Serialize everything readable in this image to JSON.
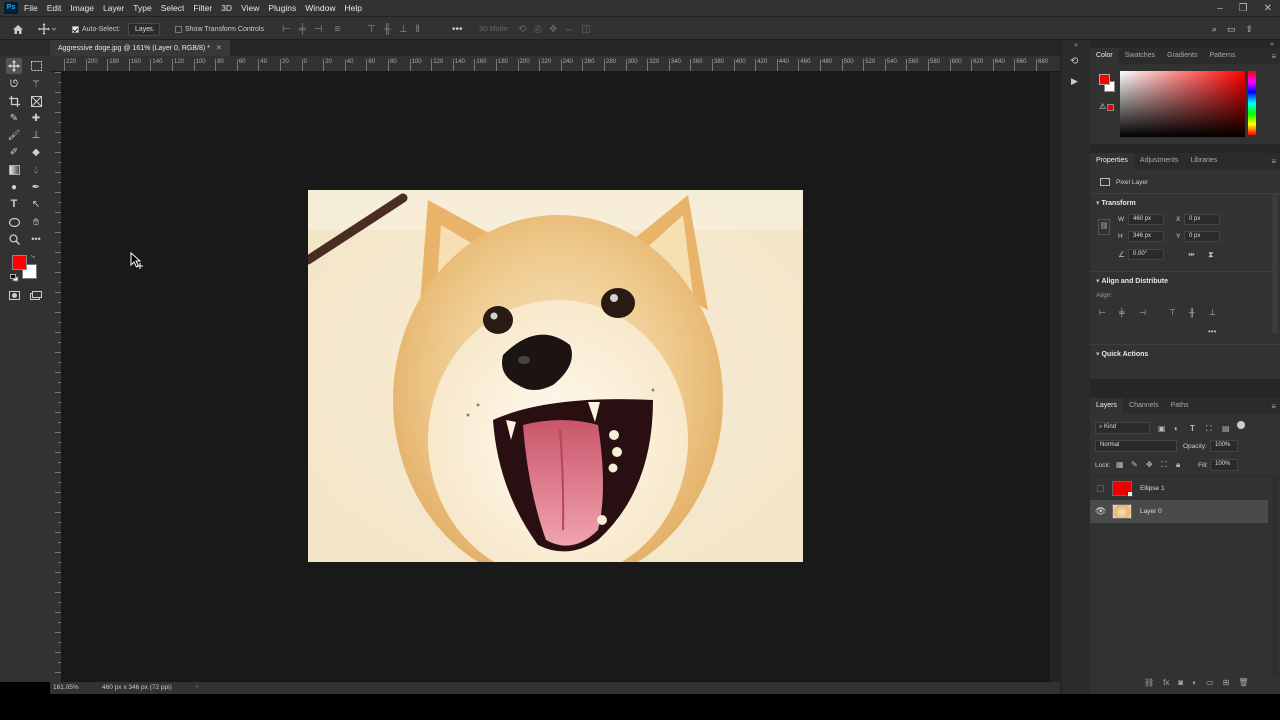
{
  "menu": {
    "logo": "Ps",
    "items": [
      "File",
      "Edit",
      "Image",
      "Layer",
      "Type",
      "Select",
      "Filter",
      "3D",
      "View",
      "Plugins",
      "Window",
      "Help"
    ]
  },
  "options": {
    "auto_select_label": "Auto-Select:",
    "auto_select_target": "Layer",
    "show_transform_label": "Show Transform Controls",
    "mode_3d_label": "3D Mode:"
  },
  "document": {
    "tab_title": "Aggressive doge.jpg @ 161% (Layer 0, RGB/8) *",
    "ruler_h": [
      "220",
      "200",
      "180",
      "160",
      "140",
      "120",
      "100",
      "80",
      "60",
      "40",
      "20",
      "0",
      "20",
      "40",
      "60",
      "80",
      "100",
      "120",
      "140",
      "160",
      "180",
      "200",
      "220",
      "240",
      "260",
      "280",
      "300",
      "320",
      "340",
      "360",
      "380",
      "400",
      "420",
      "440",
      "460",
      "480",
      "500",
      "520",
      "540",
      "560",
      "580",
      "600",
      "620",
      "640",
      "660",
      "680"
    ],
    "zoom": "161.05%",
    "doc_info": "460 px x 346 px (72 ppi)"
  },
  "colors": {
    "foreground": "#ff0000",
    "background": "#ffffff",
    "panel_bg": "#323232",
    "canvas_bg": "#191919"
  },
  "color_panel": {
    "tabs": [
      "Color",
      "Swatches",
      "Gradients",
      "Patterns"
    ],
    "active_tab": "Color"
  },
  "properties_panel": {
    "tabs": [
      "Properties",
      "Adjustments",
      "Libraries"
    ],
    "layer_type": "Pixel Layer",
    "transform_label": "Transform",
    "w_label": "W",
    "w_value": "460 px",
    "h_label": "H",
    "h_value": "346 px",
    "x_label": "X",
    "x_value": "0 px",
    "y_label": "Y",
    "y_value": "0 px",
    "angle_value": "0.00°",
    "align_distribute_label": "Align and Distribute",
    "align_label": "Align:",
    "quick_actions_label": "Quick Actions"
  },
  "layers_panel": {
    "tabs": [
      "Layers",
      "Channels",
      "Paths"
    ],
    "filter_kind": "Kind",
    "blend_mode": "Normal",
    "opacity_label": "Opacity:",
    "opacity_value": "100%",
    "lock_label": "Lock:",
    "fill_label": "Fill:",
    "fill_value": "100%",
    "layers": [
      {
        "name": "Ellipse 1",
        "visible": false,
        "selected": false
      },
      {
        "name": "Layer 0",
        "visible": true,
        "selected": true
      }
    ]
  }
}
